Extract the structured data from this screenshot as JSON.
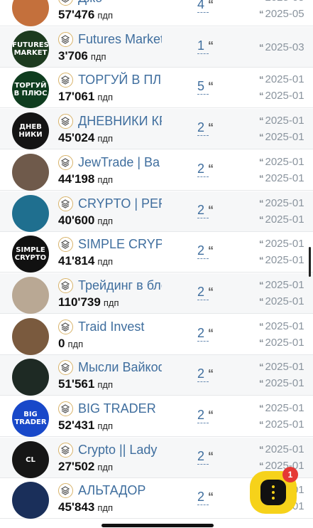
{
  "unit_label": "пдп",
  "rows": [
    {
      "name": "Джо",
      "subs": "57'476",
      "count": "4",
      "dates": [
        "2025-05",
        "2025-05"
      ],
      "avatar_text": "",
      "avatar_bg": "#c4703c"
    },
    {
      "name": "Futures Market",
      "subs": "3'706",
      "count": "1",
      "dates": [
        "2025-03"
      ],
      "avatar_text": "FUTURES MARKET",
      "avatar_bg": "#1d3b1f"
    },
    {
      "name": "ТОРГУЙ В ПЛЮС",
      "subs": "17'061",
      "count": "5",
      "dates": [
        "2025-01",
        "2025-01"
      ],
      "avatar_text": "ТОРГУЙ В ПЛЮС",
      "avatar_bg": "#0f3d1f"
    },
    {
      "name": "ДНЕВНИКИ КРИПТОМАНЬЯКА",
      "subs": "45'024",
      "count": "2",
      "dates": [
        "2025-01",
        "2025-01"
      ],
      "avatar_text": "ДНЕВ НИКИ",
      "avatar_bg": "#141414"
    },
    {
      "name": "JewTrade | Ba",
      "subs": "44'198",
      "count": "2",
      "dates": [
        "2025-01",
        "2025-01"
      ],
      "avatar_text": "",
      "avatar_bg": "#6f5a4b"
    },
    {
      "name": "CRYPTO | PERSONAL",
      "subs": "40'600",
      "count": "2",
      "dates": [
        "2025-01",
        "2025-01"
      ],
      "avatar_text": "",
      "avatar_bg": "#1f6f8f"
    },
    {
      "name": "SIMPLE CRYPTO",
      "subs": "41'814",
      "count": "2",
      "dates": [
        "2025-01",
        "2025-01"
      ],
      "avatar_text": "SIMPLE CRYPTO",
      "avatar_bg": "#111111"
    },
    {
      "name": "Трейдинг в блоге",
      "subs": "110'739",
      "count": "2",
      "dates": [
        "2025-01",
        "2025-01"
      ],
      "avatar_text": "",
      "avatar_bg": "#b9a894"
    },
    {
      "name": "Traid Invest",
      "subs": "0",
      "count": "2",
      "dates": [
        "2025-01",
        "2025-01"
      ],
      "avatar_text": "",
      "avatar_bg": "#7a5a3e"
    },
    {
      "name": "Мысли Вайкоффа",
      "subs": "51'561",
      "count": "2",
      "dates": [
        "2025-01",
        "2025-01"
      ],
      "avatar_text": "",
      "avatar_bg": "#1e2a24"
    },
    {
      "name": "BIG TRADER",
      "subs": "52'431",
      "count": "2",
      "dates": [
        "2025-01",
        "2025-01"
      ],
      "avatar_text": "BIG TRADER",
      "avatar_bg": "#1848c9"
    },
    {
      "name": "Crypto || Lady",
      "subs": "27'502",
      "count": "2",
      "dates": [
        "2025-01",
        "2025-01"
      ],
      "avatar_text": "CL",
      "avatar_bg": "#161616"
    },
    {
      "name": "АЛЬТАДОР",
      "subs": "45'843",
      "count": "2",
      "dates": [
        "2025-01",
        "2025-01"
      ],
      "avatar_text": "",
      "avatar_bg": "#1a2f5a"
    }
  ],
  "fab": {
    "icon": "chat-icon",
    "badge": "1",
    "bg": "#f6d21a"
  },
  "colors": {
    "link": "#3f6e9e",
    "date": "#8a949e",
    "row_bg": "#f6f7f8",
    "badge_ring": "#d8b36a"
  }
}
